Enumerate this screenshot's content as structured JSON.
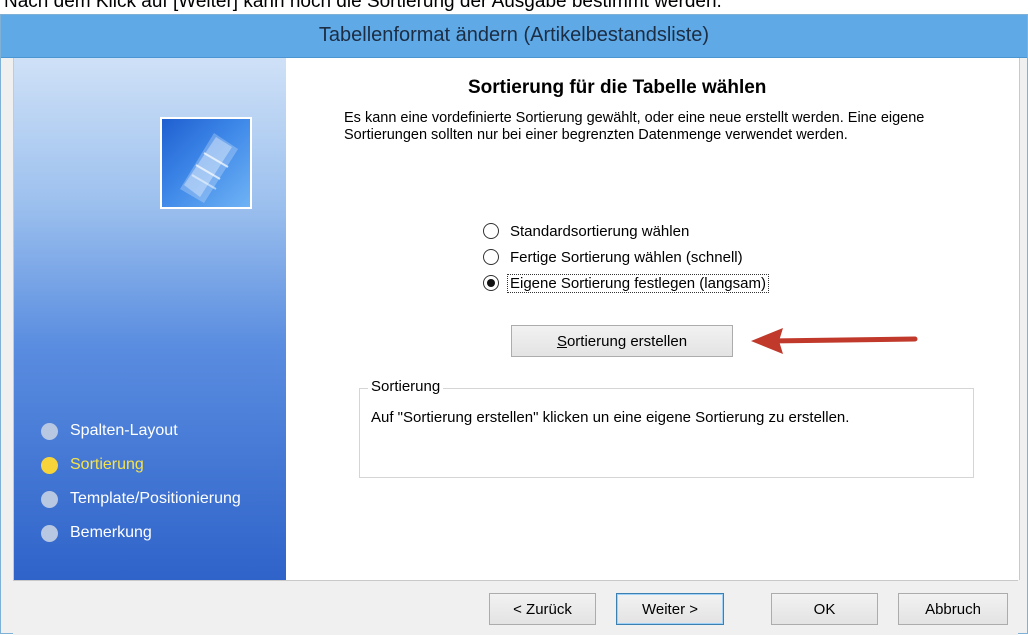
{
  "caption": "Nach dem Klick auf [Weiter] kann noch die Sortierung der Ausgabe bestimmt werden.",
  "window": {
    "title": "Tabellenformat ändern (Artikelbestandsliste)"
  },
  "sidebar": {
    "steps": [
      {
        "label": "Spalten-Layout",
        "active": false
      },
      {
        "label": "Sortierung",
        "active": true
      },
      {
        "label": "Template/Positionierung",
        "active": false
      },
      {
        "label": "Bemerkung",
        "active": false
      }
    ]
  },
  "main": {
    "title": "Sortierung für die Tabelle wählen",
    "description": "Es kann eine vordefinierte Sortierung gewählt, oder eine neue erstellt werden. Eine eigene Sortierungen sollten nur bei einer begrenzten Datenmenge verwendet werden.",
    "radios": [
      {
        "label": "Standardsortierung wählen",
        "checked": false
      },
      {
        "label": "Fertige Sortierung wählen (schnell)",
        "checked": false
      },
      {
        "label": "Eigene Sortierung festlegen (langsam)",
        "checked": true
      }
    ],
    "sort_button": {
      "mnemonic": "S",
      "rest": "ortierung erstellen"
    },
    "groupbox": {
      "legend": "Sortierung",
      "text": "Auf \"Sortierung erstellen\" klicken un eine eigene Sortierung zu erstellen."
    }
  },
  "footer": {
    "back": "< Zurück",
    "next": "Weiter >",
    "ok": "OK",
    "cancel": "Abbruch"
  },
  "colors": {
    "titlebar": "#5ea9e6",
    "active_step": "#f6d43a",
    "arrow": "#c0392b"
  }
}
